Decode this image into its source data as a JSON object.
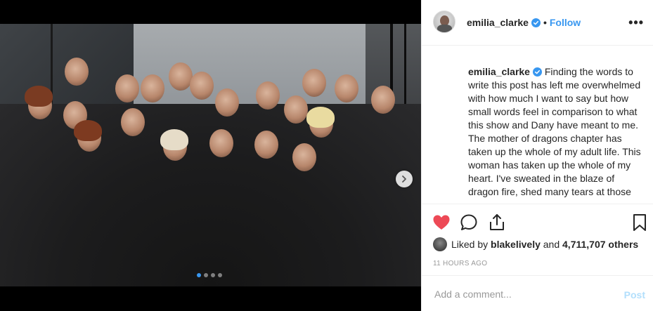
{
  "header": {
    "username": "emilia_clarke",
    "separator": "•",
    "follow_label": "Follow",
    "more_label": "•••"
  },
  "caption": {
    "username": "emilia_clarke",
    "text_lines": [
      "Finding the words to write this post has left me overwhelmed with how much I want to say but how small words feel in comparison to what this show and Dany have meant to me.",
      "The mother of dragons chapter has taken up the whole of my adult life. This woman has taken up the whole of my heart. I've sweated in the blaze of dragon fire, shed many tears at those"
    ]
  },
  "actions": {
    "like_icon": "heart-icon",
    "comment_icon": "comment-icon",
    "share_icon": "share-icon",
    "save_icon": "bookmark-icon"
  },
  "likes": {
    "prefix": "Liked by",
    "user": "blakelively",
    "and": "and",
    "count": "4,711,707 others"
  },
  "timestamp": "11 HOURS AGO",
  "comment": {
    "placeholder": "Add a comment...",
    "post_label": "Post"
  },
  "carousel": {
    "total": 4,
    "active_index": 0
  },
  "colors": {
    "accent": "#3897f0",
    "like_red": "#ed4956",
    "text": "#262626",
    "muted": "#999999"
  }
}
